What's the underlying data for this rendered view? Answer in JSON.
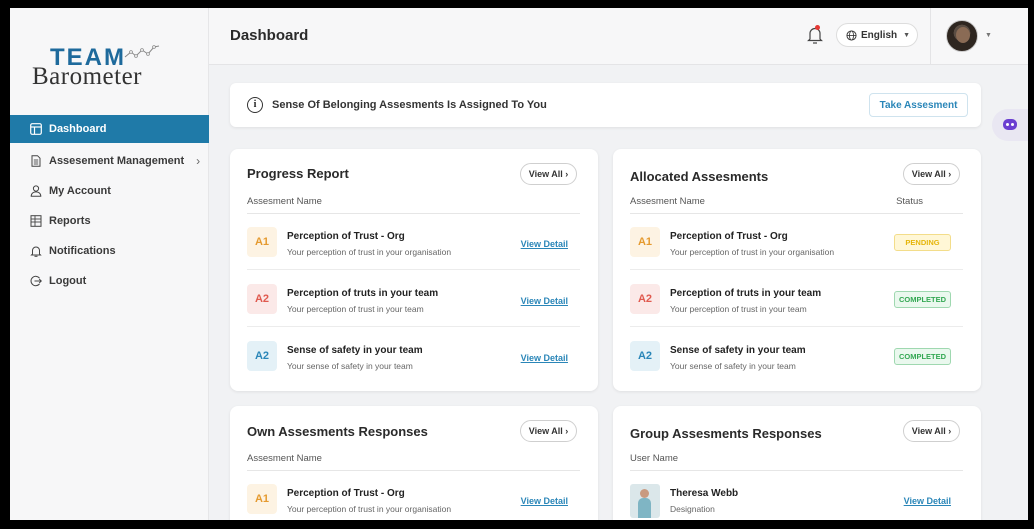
{
  "brand": {
    "team": "TEAM",
    "barometer": "Barometer"
  },
  "sidebar": {
    "items": [
      {
        "label": "Dashboard",
        "icon": "layout-icon"
      },
      {
        "label": "Assesement Management",
        "icon": "document-icon",
        "chevron": "›"
      },
      {
        "label": "My Account",
        "icon": "user-icon"
      },
      {
        "label": "Reports",
        "icon": "reports-icon"
      },
      {
        "label": "Notifications",
        "icon": "bell-icon"
      },
      {
        "label": "Logout",
        "icon": "logout-icon"
      }
    ]
  },
  "header": {
    "title": "Dashboard",
    "language": "English"
  },
  "banner": {
    "icon": "info-icon",
    "text": "Sense Of Belonging Assesments Is Assigned To You",
    "button": "Take Assesment"
  },
  "cards": {
    "progress": {
      "title": "Progress Report",
      "view_all": "View All",
      "col": "Assesment Name",
      "rows": [
        {
          "badge": "A1",
          "title": "Perception of Trust - Org",
          "sub": "Your perception of trust in your organisation",
          "link": "View Detail"
        },
        {
          "badge": "A2",
          "title": "Perception of truts in your team",
          "sub": "Your perception of trust in your team",
          "link": "View Detail"
        },
        {
          "badge": "A2",
          "title": "Sense of safety in your team",
          "sub": "Your sense of safety in your team",
          "link": "View Detail"
        }
      ]
    },
    "allocated": {
      "title": "Allocated Assesments",
      "view_all": "View All",
      "col": "Assesment Name",
      "col2": "Status",
      "rows": [
        {
          "badge": "A1",
          "title": "Perception of Trust - Org",
          "sub": "Your perception of trust in your organisation",
          "status": "PENDING"
        },
        {
          "badge": "A2",
          "title": "Perception of truts in your team",
          "sub": "Your perception of trust in your team",
          "status": "COMPLETED"
        },
        {
          "badge": "A2",
          "title": "Sense of safety in your team",
          "sub": "Your sense of safety in your team",
          "status": "COMPLETED"
        }
      ]
    },
    "own": {
      "title": "Own Assesments Responses",
      "view_all": "View All",
      "col": "Assesment Name",
      "rows": [
        {
          "badge": "A1",
          "title": "Perception of Trust - Org",
          "sub": "Your perception of trust in your organisation",
          "link": "View Detail"
        }
      ]
    },
    "group": {
      "title": "Group Assesments Responses",
      "view_all": "View All",
      "col": "User Name",
      "rows": [
        {
          "name": "Theresa Webb",
          "sub": "Designation",
          "link": "View Detail"
        }
      ]
    }
  },
  "colors": {
    "accent": "#1f7aa8",
    "link": "#2a86b8",
    "pending": "#e6b60b",
    "completed": "#34a853",
    "notification_dot": "#e53935"
  }
}
